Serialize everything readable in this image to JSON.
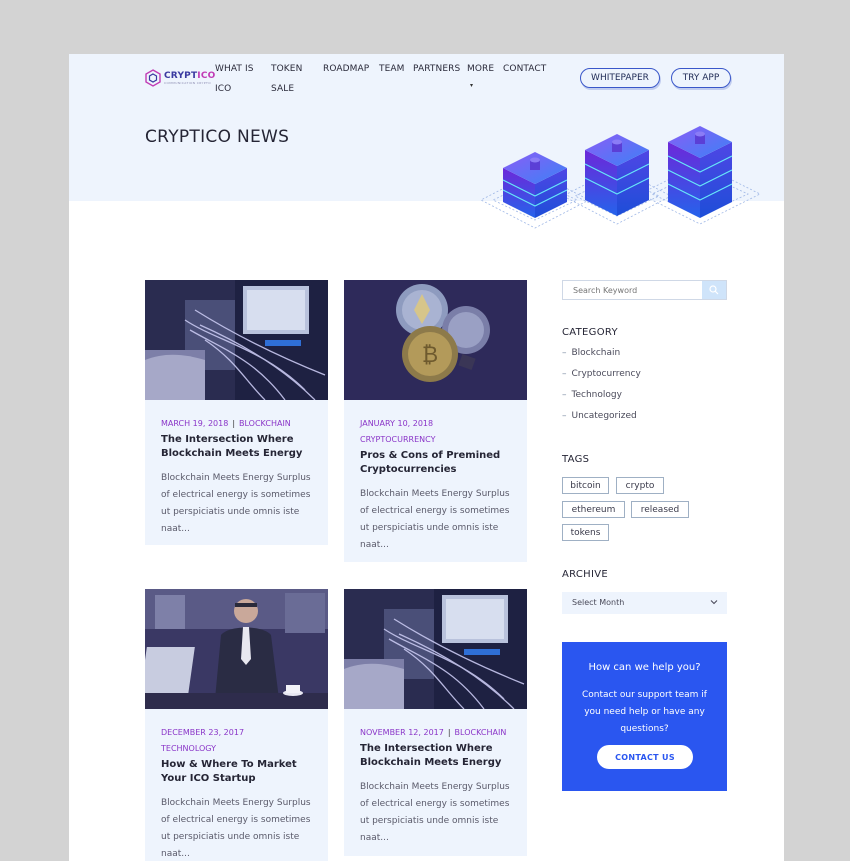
{
  "brand": {
    "name_a": "CRYPT",
    "name_b": "ICO",
    "tagline": "COMMUNICATION CRYPTO"
  },
  "nav": [
    {
      "label": "WHAT IS ICO"
    },
    {
      "label": "TOKEN SALE"
    },
    {
      "label": "ROADMAP"
    },
    {
      "label": "TEAM"
    },
    {
      "label": "PARTNERS"
    },
    {
      "label": "MORE"
    },
    {
      "label": "CONTACT"
    }
  ],
  "buttons": {
    "whitepaper": "WHITEPAPER",
    "try_app": "TRY APP"
  },
  "hero": {
    "title": "CRYPTICO NEWS"
  },
  "posts": [
    {
      "date": "MARCH 19, 2018",
      "category": "BLOCKCHAIN",
      "title": "The Intersection Where Blockchain Meets Energy",
      "excerpt": "Blockchain Meets Energy Surplus of electrical energy is sometimes ut perspiciatis unde omnis iste naat...",
      "image": "server-cables-photo"
    },
    {
      "date": "JANUARY 10, 2018",
      "category": "CRYPTOCURRENCY",
      "title": "Pros & Cons of Premined Cryptocurrencies",
      "excerpt": "Blockchain Meets Energy Surplus of electrical energy is sometimes ut perspiciatis unde omnis iste naat...",
      "image": "crypto-coins-photo"
    },
    {
      "date": "DECEMBER 23, 2017",
      "category": "TECHNOLOGY",
      "title": "How & Where To Market Your ICO Startup",
      "excerpt": "Blockchain Meets Energy Surplus of electrical energy is sometimes ut perspiciatis unde omnis iste naat...",
      "image": "businessman-laptop-photo"
    },
    {
      "date": "NOVEMBER 12, 2017",
      "category": "BLOCKCHAIN",
      "title": "The Intersection Where Blockchain Meets Energy",
      "excerpt": "Blockchain Meets Energy Surplus of electrical energy is sometimes ut perspiciatis unde omnis iste naat...",
      "image": "server-cables-photo"
    }
  ],
  "sidebar": {
    "search_placeholder": "Search Keyword",
    "category_heading": "CATEGORY",
    "categories": [
      "Blockchain",
      "Cryptocurrency",
      "Technology",
      "Uncategorized"
    ],
    "tags_heading": "TAGS",
    "tags": [
      "bitcoin",
      "crypto",
      "ethereum",
      "released",
      "tokens"
    ],
    "archive_heading": "ARCHIVE",
    "archive_select": "Select Month",
    "help": {
      "title": "How can we help you?",
      "text": "Contact our support team if you need help or have any questions?",
      "button": "CONTACT US"
    }
  },
  "colors": {
    "accent": "#2a56f0",
    "meta": "#8a35c8",
    "hero_bg": "#eef4fd",
    "card_bg": "#eef4fd"
  }
}
